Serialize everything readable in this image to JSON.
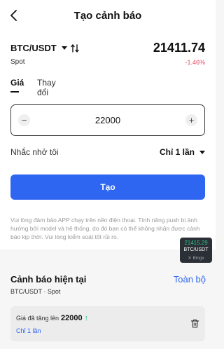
{
  "header": {
    "title": "Tạo cảnh báo",
    "back_icon": "chevron-left-icon"
  },
  "ticker": {
    "pair": "BTC/USDT",
    "market": "Spot",
    "price": "21411.74",
    "change": "-1.46%",
    "change_color": "#e0475f",
    "compare_icon": "swap-arrows-icon"
  },
  "tabs": [
    {
      "label": "Giá",
      "active": true
    },
    {
      "label": "Thay đổi",
      "active": false
    }
  ],
  "stepper": {
    "value": "22000",
    "minus_label": "−",
    "plus_label": "+"
  },
  "remind": {
    "label": "Nhắc nhở tôi",
    "value": "Chỉ 1 lần"
  },
  "create_button": {
    "label": "Tạo",
    "color": "#2f66f1"
  },
  "notice": "Vui lòng đảm bảo APP chạy trên nền điện thoại. Tính năng push bị ảnh hưởng bởi model và hệ thống, do đó bạn có thể không nhận được cảnh báo kịp thời. Vui lòng kiểm soát tốt rủi ro.",
  "floating_ticker": {
    "price": "21415.29",
    "pair": "BTC/USDT",
    "brand": "Bingx"
  },
  "current_alerts": {
    "title": "Cảnh báo hiện tại",
    "view_all": "Toàn bộ",
    "pair_market": "BTC/USDT · Spot",
    "alerts": [
      {
        "condition": "Giá đã tăng lên",
        "value": "22000",
        "direction_icon": "arrow-up-icon",
        "frequency": "Chỉ 1 lần"
      }
    ]
  }
}
